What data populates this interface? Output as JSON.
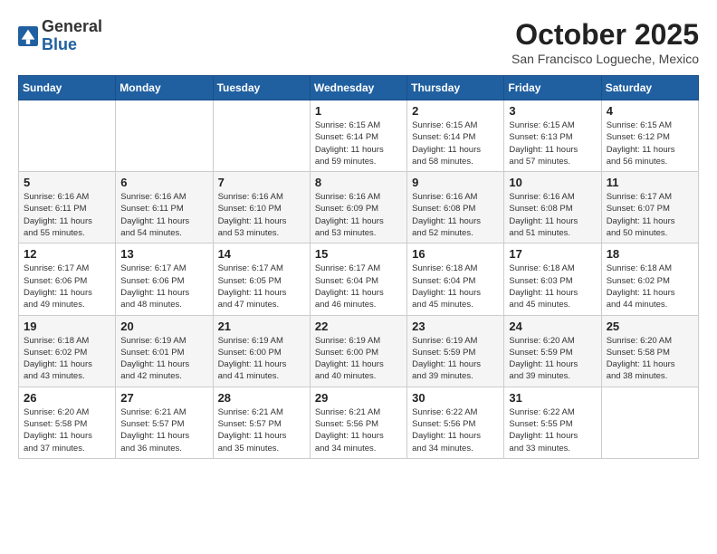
{
  "header": {
    "logo_general": "General",
    "logo_blue": "Blue",
    "month_title": "October 2025",
    "location": "San Francisco Logueche, Mexico"
  },
  "weekdays": [
    "Sunday",
    "Monday",
    "Tuesday",
    "Wednesday",
    "Thursday",
    "Friday",
    "Saturday"
  ],
  "weeks": [
    [
      {
        "day": "",
        "info": ""
      },
      {
        "day": "",
        "info": ""
      },
      {
        "day": "",
        "info": ""
      },
      {
        "day": "1",
        "info": "Sunrise: 6:15 AM\nSunset: 6:14 PM\nDaylight: 11 hours\nand 59 minutes."
      },
      {
        "day": "2",
        "info": "Sunrise: 6:15 AM\nSunset: 6:14 PM\nDaylight: 11 hours\nand 58 minutes."
      },
      {
        "day": "3",
        "info": "Sunrise: 6:15 AM\nSunset: 6:13 PM\nDaylight: 11 hours\nand 57 minutes."
      },
      {
        "day": "4",
        "info": "Sunrise: 6:15 AM\nSunset: 6:12 PM\nDaylight: 11 hours\nand 56 minutes."
      }
    ],
    [
      {
        "day": "5",
        "info": "Sunrise: 6:16 AM\nSunset: 6:11 PM\nDaylight: 11 hours\nand 55 minutes."
      },
      {
        "day": "6",
        "info": "Sunrise: 6:16 AM\nSunset: 6:11 PM\nDaylight: 11 hours\nand 54 minutes."
      },
      {
        "day": "7",
        "info": "Sunrise: 6:16 AM\nSunset: 6:10 PM\nDaylight: 11 hours\nand 53 minutes."
      },
      {
        "day": "8",
        "info": "Sunrise: 6:16 AM\nSunset: 6:09 PM\nDaylight: 11 hours\nand 53 minutes."
      },
      {
        "day": "9",
        "info": "Sunrise: 6:16 AM\nSunset: 6:08 PM\nDaylight: 11 hours\nand 52 minutes."
      },
      {
        "day": "10",
        "info": "Sunrise: 6:16 AM\nSunset: 6:08 PM\nDaylight: 11 hours\nand 51 minutes."
      },
      {
        "day": "11",
        "info": "Sunrise: 6:17 AM\nSunset: 6:07 PM\nDaylight: 11 hours\nand 50 minutes."
      }
    ],
    [
      {
        "day": "12",
        "info": "Sunrise: 6:17 AM\nSunset: 6:06 PM\nDaylight: 11 hours\nand 49 minutes."
      },
      {
        "day": "13",
        "info": "Sunrise: 6:17 AM\nSunset: 6:06 PM\nDaylight: 11 hours\nand 48 minutes."
      },
      {
        "day": "14",
        "info": "Sunrise: 6:17 AM\nSunset: 6:05 PM\nDaylight: 11 hours\nand 47 minutes."
      },
      {
        "day": "15",
        "info": "Sunrise: 6:17 AM\nSunset: 6:04 PM\nDaylight: 11 hours\nand 46 minutes."
      },
      {
        "day": "16",
        "info": "Sunrise: 6:18 AM\nSunset: 6:04 PM\nDaylight: 11 hours\nand 45 minutes."
      },
      {
        "day": "17",
        "info": "Sunrise: 6:18 AM\nSunset: 6:03 PM\nDaylight: 11 hours\nand 45 minutes."
      },
      {
        "day": "18",
        "info": "Sunrise: 6:18 AM\nSunset: 6:02 PM\nDaylight: 11 hours\nand 44 minutes."
      }
    ],
    [
      {
        "day": "19",
        "info": "Sunrise: 6:18 AM\nSunset: 6:02 PM\nDaylight: 11 hours\nand 43 minutes."
      },
      {
        "day": "20",
        "info": "Sunrise: 6:19 AM\nSunset: 6:01 PM\nDaylight: 11 hours\nand 42 minutes."
      },
      {
        "day": "21",
        "info": "Sunrise: 6:19 AM\nSunset: 6:00 PM\nDaylight: 11 hours\nand 41 minutes."
      },
      {
        "day": "22",
        "info": "Sunrise: 6:19 AM\nSunset: 6:00 PM\nDaylight: 11 hours\nand 40 minutes."
      },
      {
        "day": "23",
        "info": "Sunrise: 6:19 AM\nSunset: 5:59 PM\nDaylight: 11 hours\nand 39 minutes."
      },
      {
        "day": "24",
        "info": "Sunrise: 6:20 AM\nSunset: 5:59 PM\nDaylight: 11 hours\nand 39 minutes."
      },
      {
        "day": "25",
        "info": "Sunrise: 6:20 AM\nSunset: 5:58 PM\nDaylight: 11 hours\nand 38 minutes."
      }
    ],
    [
      {
        "day": "26",
        "info": "Sunrise: 6:20 AM\nSunset: 5:58 PM\nDaylight: 11 hours\nand 37 minutes."
      },
      {
        "day": "27",
        "info": "Sunrise: 6:21 AM\nSunset: 5:57 PM\nDaylight: 11 hours\nand 36 minutes."
      },
      {
        "day": "28",
        "info": "Sunrise: 6:21 AM\nSunset: 5:57 PM\nDaylight: 11 hours\nand 35 minutes."
      },
      {
        "day": "29",
        "info": "Sunrise: 6:21 AM\nSunset: 5:56 PM\nDaylight: 11 hours\nand 34 minutes."
      },
      {
        "day": "30",
        "info": "Sunrise: 6:22 AM\nSunset: 5:56 PM\nDaylight: 11 hours\nand 34 minutes."
      },
      {
        "day": "31",
        "info": "Sunrise: 6:22 AM\nSunset: 5:55 PM\nDaylight: 11 hours\nand 33 minutes."
      },
      {
        "day": "",
        "info": ""
      }
    ]
  ]
}
